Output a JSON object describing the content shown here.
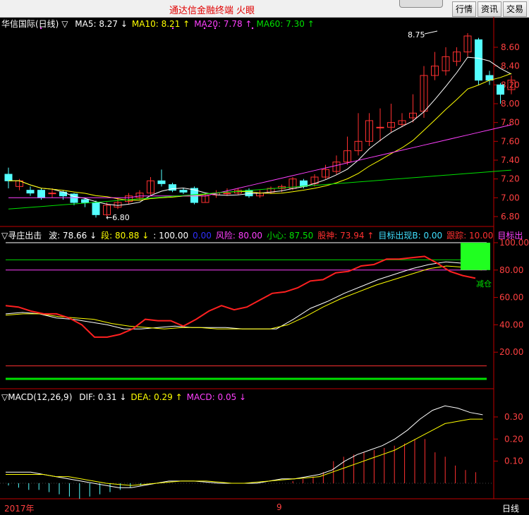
{
  "window": {
    "title": "通达信金融终端  火眼",
    "buttons": [
      {
        "label": "行情"
      },
      {
        "label": "资讯"
      },
      {
        "label": "交易"
      }
    ]
  },
  "main": {
    "stock": "华信国际(日线)",
    "ma": [
      {
        "label": "MA5: 8.27",
        "arrow": "↓",
        "color": "#ffffff"
      },
      {
        "label": "MA10: 8.21",
        "arrow": "↑",
        "color": "#ffff00"
      },
      {
        "label": "MA20: 7.78",
        "arrow": "↑",
        "color": "#ff40ff"
      },
      {
        "label": "MA60: 7.30",
        "arrow": "↑",
        "color": "#00e000"
      }
    ],
    "y_ticks": [
      "8.60",
      "8.40",
      "8.20",
      "8.00",
      "7.80",
      "7.60",
      "7.40",
      "7.20",
      "7.00",
      "6.80"
    ],
    "high_label": "8.75",
    "low_label": "6.80"
  },
  "indicator": {
    "name": "寻庄出击",
    "items": [
      {
        "text": "波: 78.66",
        "arrow": "↓",
        "color": "#ffffff"
      },
      {
        "text": "段: 80.88",
        "arrow": "↓",
        "color": "#ffff00"
      },
      {
        "text": ": 100.00",
        "arrow": "",
        "color": "#ffffff"
      },
      {
        "text": "0.00",
        "arrow": "",
        "color": "#3030ff"
      },
      {
        "text": "风险: 80.00",
        "arrow": "",
        "color": "#ff40ff"
      },
      {
        "text": "小心: 87.50",
        "arrow": "",
        "color": "#00e000"
      },
      {
        "text": "股神: 73.94",
        "arrow": "↑",
        "color": "#ff3030"
      },
      {
        "text": "目标出现B: 0.00",
        "arrow": "",
        "color": "#40e0ff"
      },
      {
        "text": "跟踪: 10.00",
        "arrow": "",
        "color": "#ff3030"
      },
      {
        "text": "目标出",
        "arrow": "",
        "color": "#ff40ff"
      }
    ],
    "y_ticks": [
      "100.00",
      "80.00",
      "60.00",
      "40.00",
      "20.00"
    ],
    "signal": "减仓"
  },
  "macd": {
    "name": "MACD(12,26,9)",
    "items": [
      {
        "text": "DIF: 0.31",
        "arrow": "↓",
        "color": "#ffffff"
      },
      {
        "text": "DEA: 0.29",
        "arrow": "↑",
        "color": "#ffff00"
      },
      {
        "text": "MACD: 0.05",
        "arrow": "↓",
        "color": "#ff40ff"
      }
    ],
    "y_ticks": [
      "0.30",
      "0.20",
      "0.10"
    ]
  },
  "footer": {
    "year": "2017年",
    "month": "9",
    "period": "日线"
  },
  "colors": {
    "up": "#ff3030",
    "down": "#54ffff",
    "axis": "#c00000"
  }
}
